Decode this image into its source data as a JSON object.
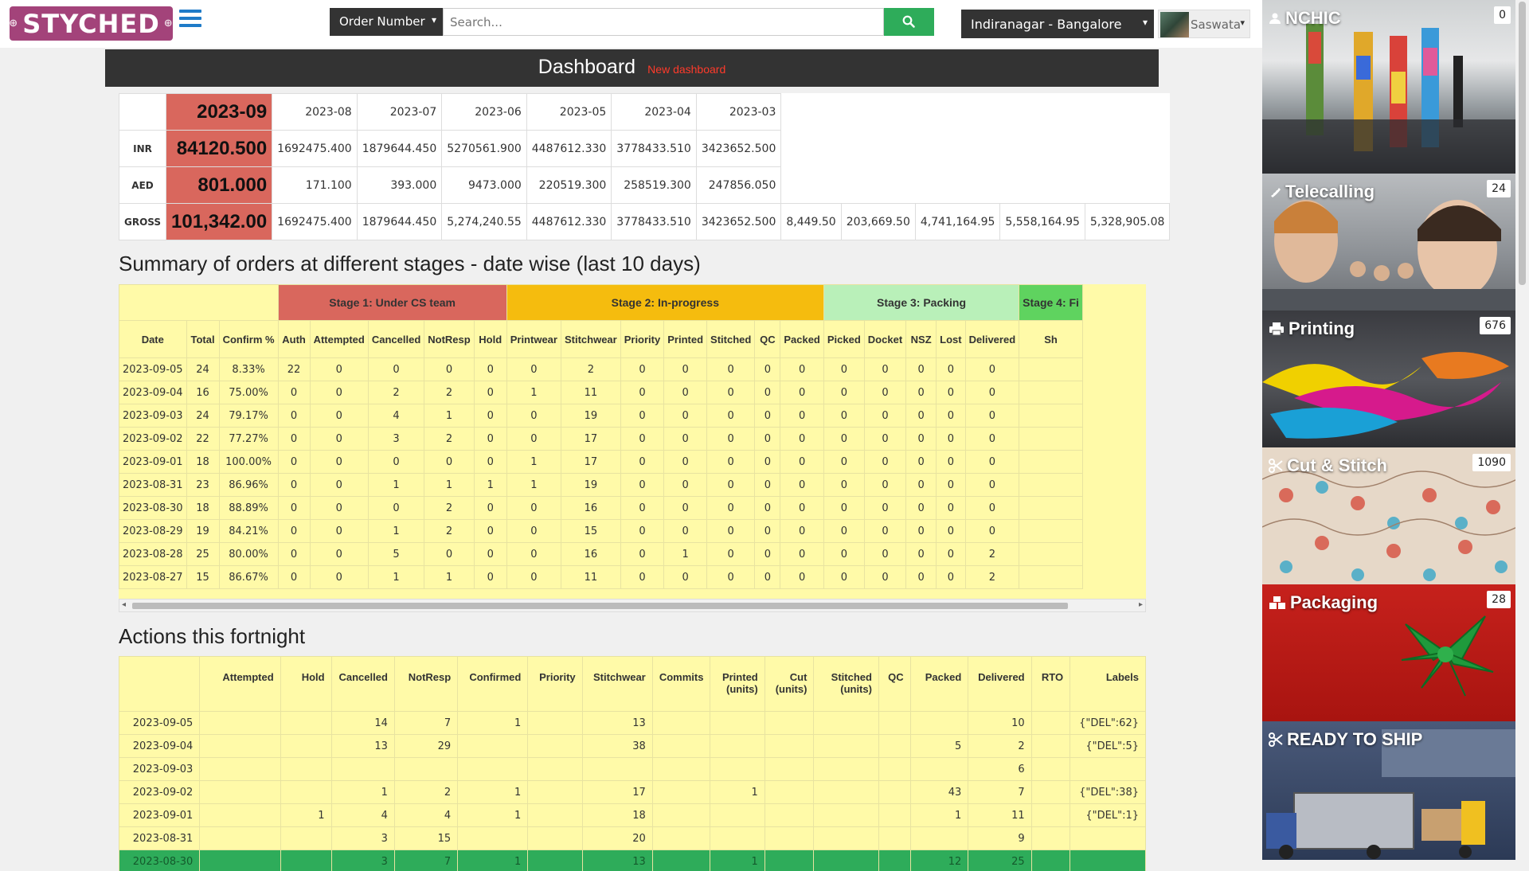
{
  "header": {
    "logo_text": "STYCHED",
    "search_type": "Order Number",
    "search_placeholder": "Search...",
    "location": "Indiranagar - Bangalore",
    "user_name": "Saswata"
  },
  "dashboard": {
    "title": "Dashboard",
    "new_link": "New dashboard"
  },
  "summary": {
    "months": [
      "2023-09",
      "2023-08",
      "2023-07",
      "2023-06",
      "2023-05",
      "2023-04",
      "2023-03"
    ],
    "rows": [
      {
        "label": "INR",
        "values": [
          "84120.500",
          "1692475.400",
          "1879644.450",
          "5270561.900",
          "4487612.330",
          "3778433.510",
          "3423652.500"
        ]
      },
      {
        "label": "AED",
        "values": [
          "801.000",
          "171.100",
          "393.000",
          "9473.000",
          "220519.300",
          "258519.300",
          "247856.050"
        ]
      },
      {
        "label": "GROSS",
        "values": [
          "101,342.00",
          "1692475.400",
          "1879644.450",
          "5,274,240.55",
          "4487612.330",
          "3778433.510",
          "3423652.500",
          "8,449.50",
          "203,669.50",
          "4,741,164.95",
          "5,558,164.95",
          "5,328,905.08"
        ]
      }
    ]
  },
  "stages": {
    "title": "Summary of orders at different stages - date wise (last 10 days)",
    "stage_headers": [
      "Stage 1: Under CS team",
      "Stage 2: In-progress",
      "Stage 3: Packing",
      "Stage 4: Fi"
    ],
    "columns": [
      "Date",
      "Total",
      "Confirm %",
      "Auth",
      "Attempted",
      "Cancelled",
      "NotResp",
      "Hold",
      "Printwear",
      "Stitchwear",
      "Priority",
      "Printed",
      "Stitched",
      "QC",
      "Packed",
      "Picked",
      "Docket",
      "NSZ",
      "Lost",
      "Delivered",
      "Sh"
    ],
    "rows": [
      [
        "2023-09-05",
        "24",
        "8.33%",
        "22",
        "0",
        "0",
        "0",
        "0",
        "0",
        "2",
        "0",
        "0",
        "0",
        "0",
        "0",
        "0",
        "0",
        "0",
        "0",
        "0",
        ""
      ],
      [
        "2023-09-04",
        "16",
        "75.00%",
        "0",
        "0",
        "2",
        "2",
        "0",
        "1",
        "11",
        "0",
        "0",
        "0",
        "0",
        "0",
        "0",
        "0",
        "0",
        "0",
        "0",
        ""
      ],
      [
        "2023-09-03",
        "24",
        "79.17%",
        "0",
        "0",
        "4",
        "1",
        "0",
        "0",
        "19",
        "0",
        "0",
        "0",
        "0",
        "0",
        "0",
        "0",
        "0",
        "0",
        "0",
        ""
      ],
      [
        "2023-09-02",
        "22",
        "77.27%",
        "0",
        "0",
        "3",
        "2",
        "0",
        "0",
        "17",
        "0",
        "0",
        "0",
        "0",
        "0",
        "0",
        "0",
        "0",
        "0",
        "0",
        ""
      ],
      [
        "2023-09-01",
        "18",
        "100.00%",
        "0",
        "0",
        "0",
        "0",
        "0",
        "1",
        "17",
        "0",
        "0",
        "0",
        "0",
        "0",
        "0",
        "0",
        "0",
        "0",
        "0",
        ""
      ],
      [
        "2023-08-31",
        "23",
        "86.96%",
        "0",
        "0",
        "1",
        "1",
        "1",
        "1",
        "19",
        "0",
        "0",
        "0",
        "0",
        "0",
        "0",
        "0",
        "0",
        "0",
        "0",
        ""
      ],
      [
        "2023-08-30",
        "18",
        "88.89%",
        "0",
        "0",
        "0",
        "2",
        "0",
        "0",
        "16",
        "0",
        "0",
        "0",
        "0",
        "0",
        "0",
        "0",
        "0",
        "0",
        "0",
        ""
      ],
      [
        "2023-08-29",
        "19",
        "84.21%",
        "0",
        "0",
        "1",
        "2",
        "0",
        "0",
        "15",
        "0",
        "0",
        "0",
        "0",
        "0",
        "0",
        "0",
        "0",
        "0",
        "0",
        ""
      ],
      [
        "2023-08-28",
        "25",
        "80.00%",
        "0",
        "0",
        "5",
        "0",
        "0",
        "0",
        "16",
        "0",
        "1",
        "0",
        "0",
        "0",
        "0",
        "0",
        "0",
        "0",
        "2",
        ""
      ],
      [
        "2023-08-27",
        "15",
        "86.67%",
        "0",
        "0",
        "1",
        "1",
        "0",
        "0",
        "11",
        "0",
        "0",
        "0",
        "0",
        "0",
        "0",
        "0",
        "0",
        "0",
        "2",
        ""
      ]
    ]
  },
  "actions": {
    "title": "Actions this fortnight",
    "columns": [
      "",
      "Attempted",
      "Hold",
      "Cancelled",
      "NotResp",
      "Confirmed",
      "Priority",
      "Stitchwear",
      "Commits",
      "Printed (units)",
      "Cut (units)",
      "Stitched (units)",
      "QC",
      "Packed",
      "Delivered",
      "RTO",
      "Labels"
    ],
    "rows": [
      [
        "2023-09-05",
        "",
        "",
        "14",
        "7",
        "1",
        "",
        "13",
        "",
        "",
        "",
        "",
        "",
        "",
        "10",
        "",
        "{\"DEL\":62}"
      ],
      [
        "2023-09-04",
        "",
        "",
        "13",
        "29",
        "",
        "",
        "38",
        "",
        "",
        "",
        "",
        "",
        "5",
        "2",
        "",
        "{\"DEL\":5}"
      ],
      [
        "2023-09-03",
        "",
        "",
        "",
        "",
        "",
        "",
        "",
        "",
        "",
        "",
        "",
        "",
        "",
        "6",
        "",
        ""
      ],
      [
        "2023-09-02",
        "",
        "",
        "1",
        "2",
        "1",
        "",
        "17",
        "",
        "1",
        "",
        "",
        "",
        "43",
        "7",
        "",
        "{\"DEL\":38}"
      ],
      [
        "2023-09-01",
        "",
        "1",
        "4",
        "4",
        "1",
        "",
        "18",
        "",
        "",
        "",
        "",
        "",
        "1",
        "11",
        "",
        "{\"DEL\":1}"
      ],
      [
        "2023-08-31",
        "",
        "",
        "3",
        "15",
        "",
        "",
        "20",
        "",
        "",
        "",
        "",
        "",
        "",
        "9",
        "",
        ""
      ],
      [
        "2023-08-30",
        "",
        "",
        "3",
        "7",
        "1",
        "",
        "13",
        "",
        "1",
        "",
        "",
        "",
        "12",
        "25",
        "",
        ""
      ]
    ]
  },
  "sidebar": {
    "tiles": [
      {
        "name": "NCHIC",
        "count": "0",
        "icon": "user-icon"
      },
      {
        "name": "Telecalling",
        "count": "24",
        "icon": "phone-icon"
      },
      {
        "name": "Printing",
        "count": "676",
        "icon": "printer-icon"
      },
      {
        "name": "Cut & Stitch",
        "count": "1090",
        "icon": "scissors-icon"
      },
      {
        "name": "Packaging",
        "count": "28",
        "icon": "boxes-icon"
      },
      {
        "name": "READY TO SHIP",
        "count": "",
        "icon": "scissors-icon"
      }
    ]
  },
  "colors": {
    "brand": "#a3437a",
    "stage1": "#d9675d",
    "stage2": "#f5bc0e",
    "stage3": "#b9f0b9",
    "stage4": "#5fd35f",
    "table_bg": "#fffaa8",
    "search_button": "#2eac5a"
  }
}
